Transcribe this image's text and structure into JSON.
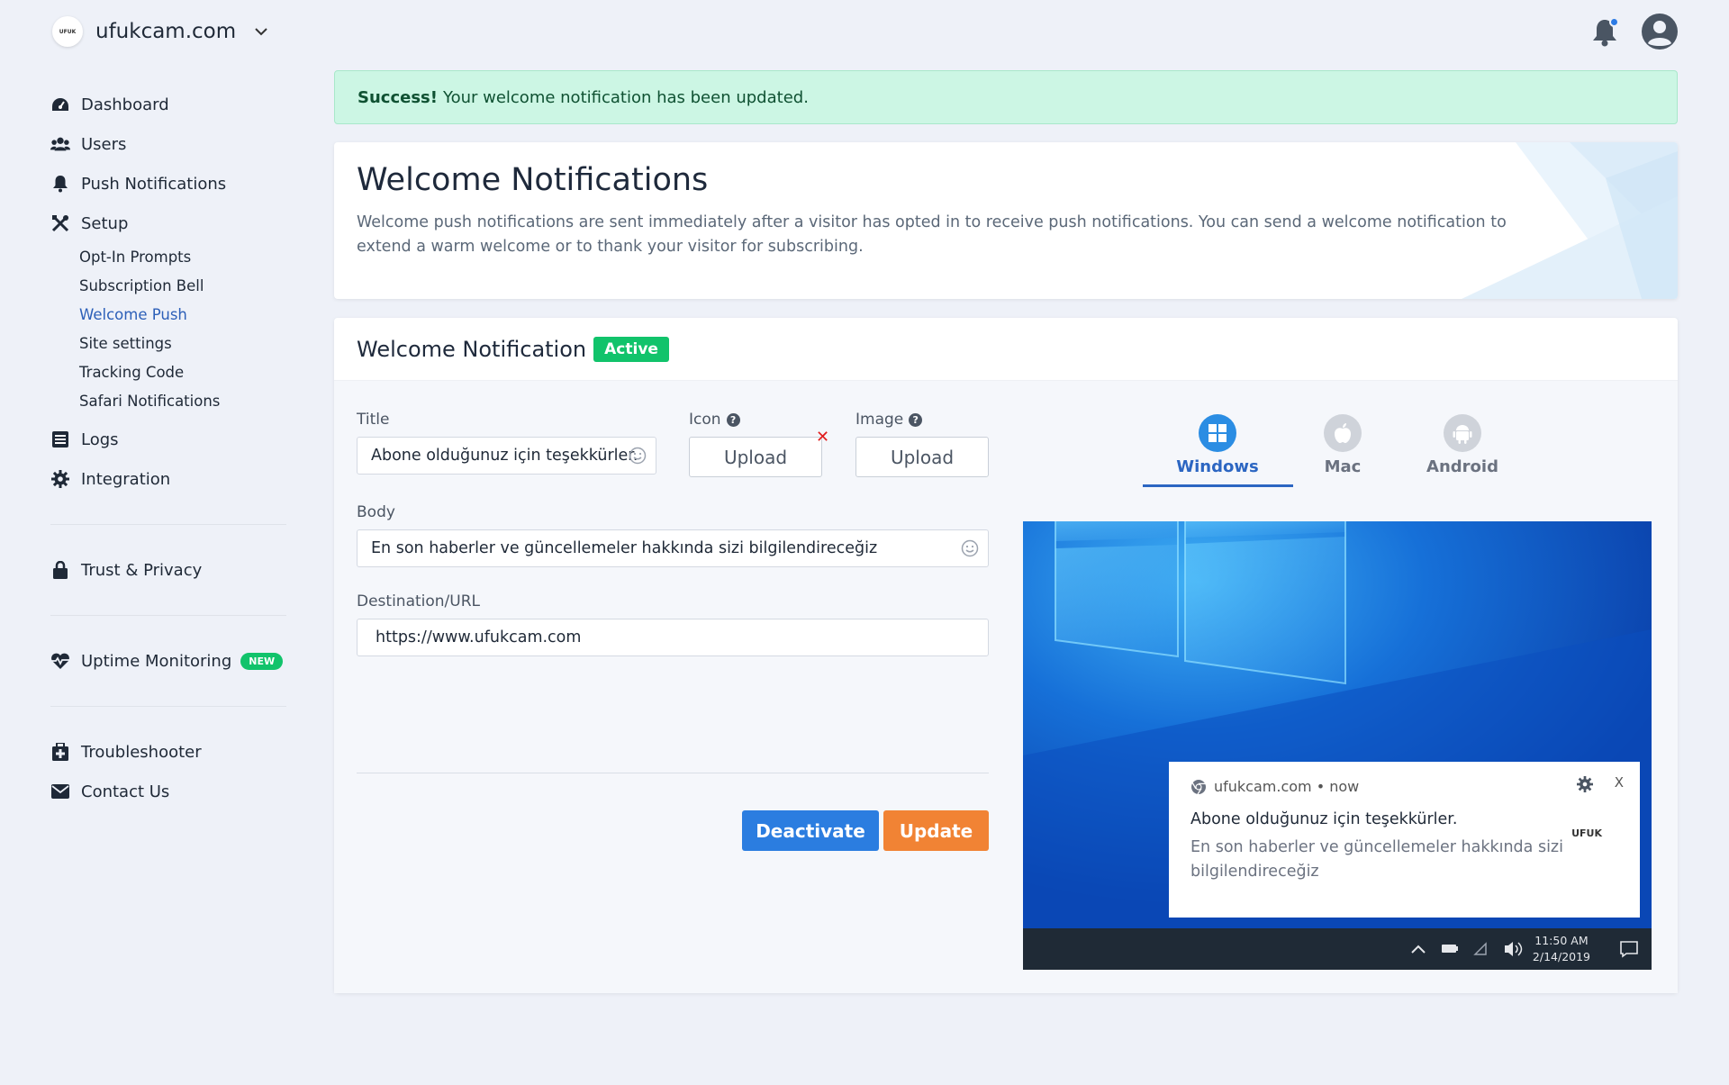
{
  "site": {
    "logo_text": "UFUK",
    "name": "ufukcam.com"
  },
  "sidebar": {
    "items": [
      {
        "label": "Dashboard"
      },
      {
        "label": "Users"
      },
      {
        "label": "Push Notifications"
      },
      {
        "label": "Setup"
      }
    ],
    "setup_sub": [
      {
        "label": "Opt-In Prompts"
      },
      {
        "label": "Subscription Bell"
      },
      {
        "label": "Welcome Push"
      },
      {
        "label": "Site settings"
      },
      {
        "label": "Tracking Code"
      },
      {
        "label": "Safari Notifications"
      }
    ],
    "items2": [
      {
        "label": "Logs"
      },
      {
        "label": "Integration"
      }
    ],
    "trust": "Trust & Privacy",
    "uptime": "Uptime Monitoring",
    "uptime_badge": "NEW",
    "troubleshooter": "Troubleshooter",
    "contact": "Contact Us"
  },
  "alert": {
    "strong": "Success!",
    "message": "Your welcome notification has been updated."
  },
  "header": {
    "title": "Welcome Notifications",
    "description": "Welcome push notifications are sent immediately after a visitor has opted in to receive push notifications. You can send a welcome notification to extend a warm welcome or to thank your visitor for subscribing."
  },
  "form": {
    "card_title": "Welcome Notification",
    "status_badge": "Active",
    "title_label": "Title",
    "title_value": "Abone olduğunuz için teşekkürler.",
    "icon_label": "Icon",
    "image_label": "Image",
    "upload_label": "Upload",
    "remove_mark": "✕",
    "body_label": "Body",
    "body_value": "En son haberler ve güncellemeler hakkında sizi bilgilendireceğiz",
    "url_label": "Destination/URL",
    "url_value": "https://www.ufukcam.com",
    "deactivate": "Deactivate",
    "update": "Update"
  },
  "preview": {
    "tabs": [
      {
        "label": "Windows",
        "active": true
      },
      {
        "label": "Mac",
        "active": false
      },
      {
        "label": "Android",
        "active": false
      }
    ],
    "toast": {
      "source": "ufukcam.com • now",
      "close": "X",
      "title": "Abone olduğunuz için teşekkürler.",
      "body": "En son haberler ve güncellemeler hakkında sizi bilgilendireceğiz",
      "logo_text": "UFUK"
    },
    "clock_time": "11:50 AM",
    "clock_date": "2/14/2019"
  },
  "colors": {
    "accent": "#2c66c2",
    "success": "#11c36b",
    "primary_button": "#2b7de0",
    "update_button": "#f18334"
  }
}
